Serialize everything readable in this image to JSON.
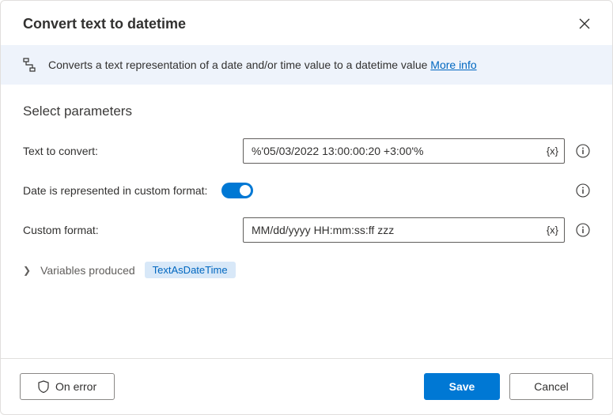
{
  "header": {
    "title": "Convert text to datetime"
  },
  "banner": {
    "text": "Converts a text representation of a date and/or time value to a datetime value ",
    "more_link": "More info"
  },
  "section": {
    "title": "Select parameters"
  },
  "fields": {
    "text_to_convert": {
      "label": "Text to convert:",
      "value": "%'05/03/2022 13:00:00:20 +3:00'%"
    },
    "custom_format_toggle": {
      "label": "Date is represented in custom format:",
      "on": true
    },
    "custom_format": {
      "label": "Custom format:",
      "value": "MM/dd/yyyy HH:mm:ss:ff zzz"
    },
    "var_insert_label": "{x}"
  },
  "variables": {
    "label": "Variables produced",
    "chip": "TextAsDateTime"
  },
  "footer": {
    "on_error": "On error",
    "save": "Save",
    "cancel": "Cancel"
  }
}
